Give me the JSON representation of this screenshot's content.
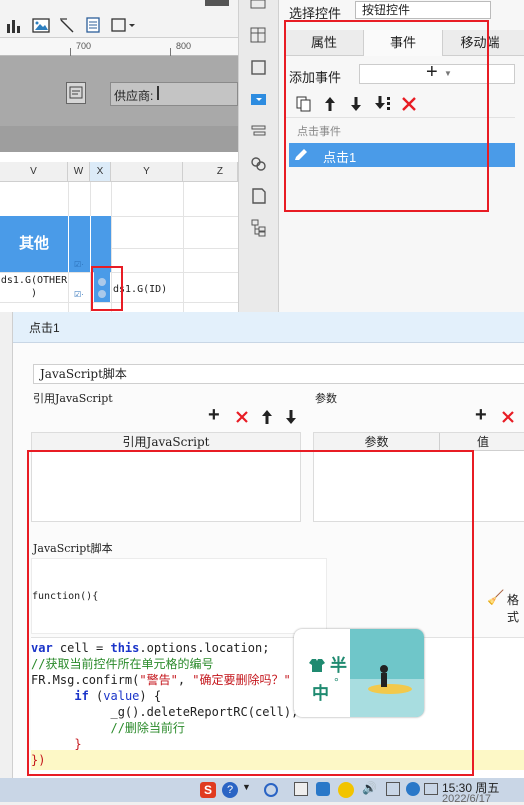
{
  "ruler": {
    "mark1": "700",
    "mark2": "800"
  },
  "canvas": {
    "supplier_label": "供应商:"
  },
  "grid": {
    "columns": [
      "V",
      "W",
      "X",
      "Y",
      "Z"
    ],
    "header_cell": "其他",
    "cell_formula_left": "ds1.G(OTHER\n)",
    "cell_formula_right": "ds1.G(ID)"
  },
  "rpanel": {
    "select_label": "选择控件",
    "select_value": "按钮控件",
    "tabs": [
      "属性",
      "事件",
      "移动端"
    ],
    "add_event_label": "添加事件",
    "add_plus": "+",
    "section_label": "点击事件",
    "event_item": "点击1"
  },
  "dialog": {
    "title": "点击1",
    "type_value": "JavaScript脚本",
    "ref_js_label": "引用JavaScript",
    "params_label": "参数",
    "col_ref_js": "引用JavaScript",
    "col_params": "参数",
    "col_value": "值",
    "js_section_label": "JavaScript脚本",
    "function_label": "function(){",
    "format_label": "格式",
    "code": [
      "var cell = this.options.location;",
      "//获取当前控件所在单元格的编号",
      "FR.Msg.confirm(\"警告\", \"确定要删除吗？\"",
      "      if (value) {",
      "           _g().deleteReportRC(cell);",
      "           //删除当前行",
      "      }",
      "})"
    ]
  },
  "overlay": {
    "text1": "半",
    "text2": "中",
    "deg": "°"
  },
  "taskbar": {
    "time": "15:30 周五",
    "date": "2022/6/17"
  },
  "colors": {
    "accent": "#4a9be8",
    "red": "#e81c24",
    "selected": "#4a9be8"
  }
}
